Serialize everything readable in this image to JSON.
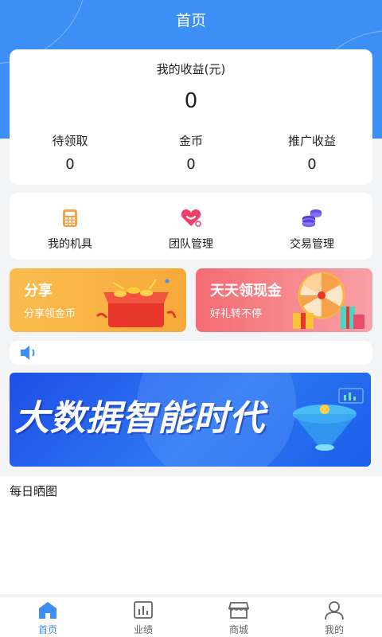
{
  "header": {
    "title": "首页"
  },
  "earnings": {
    "title": "我的收益(元)",
    "total": "0",
    "stats": [
      {
        "label": "待领取",
        "value": "0"
      },
      {
        "label": "金币",
        "value": "0"
      },
      {
        "label": "推广收益",
        "value": "0"
      }
    ]
  },
  "menu": {
    "items": [
      {
        "label": "我的机具",
        "icon": "calculator-icon"
      },
      {
        "label": "团队管理",
        "icon": "heart-icon"
      },
      {
        "label": "交易管理",
        "icon": "coins-icon"
      }
    ]
  },
  "promos": {
    "share": {
      "title": "分享",
      "subtitle": "分享领金币"
    },
    "cash": {
      "title": "天天领现金",
      "subtitle": "好礼转不停"
    }
  },
  "banner": {
    "text": "大数据智能时代"
  },
  "daily": {
    "title": "每日晒图"
  },
  "tabbar": {
    "tabs": [
      {
        "label": "首页",
        "icon": "home-icon",
        "active": true
      },
      {
        "label": "业绩",
        "icon": "chart-icon",
        "active": false
      },
      {
        "label": "商城",
        "icon": "store-icon",
        "active": false
      },
      {
        "label": "我的",
        "icon": "user-icon",
        "active": false
      }
    ]
  },
  "colors": {
    "primary": "#3d8ff5",
    "share_card": "#fbbd4e",
    "cash_card": "#f56b73"
  }
}
